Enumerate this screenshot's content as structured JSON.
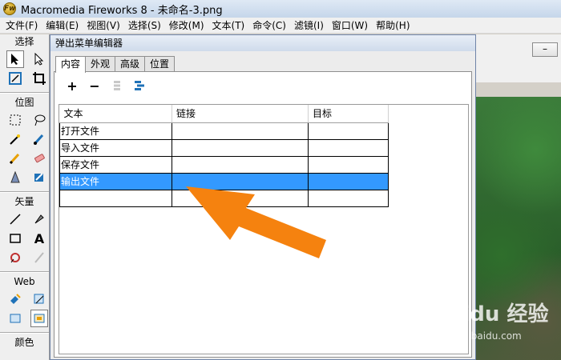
{
  "window": {
    "title": "Macromedia Fireworks 8 - 未命名-3.png",
    "logo": "Fw"
  },
  "menubar": {
    "items": [
      "文件(F)",
      "编辑(E)",
      "视图(V)",
      "选择(S)",
      "修改(M)",
      "文本(T)",
      "命令(C)",
      "滤镜(I)",
      "窗口(W)",
      "帮助(H)"
    ]
  },
  "toolbox": {
    "sections": {
      "select": "选择",
      "bitmap": "位图",
      "vector": "矢量",
      "web": "Web",
      "colors": "颜色"
    },
    "vector_text_tool": "A"
  },
  "dialog": {
    "title": "弹出菜单编辑器",
    "tabs": [
      "内容",
      "外观",
      "高级",
      "位置"
    ],
    "toolbar": {
      "add": "+",
      "remove": "−"
    },
    "table": {
      "headers": [
        "文本",
        "链接",
        "目标"
      ],
      "rows": [
        [
          "打开文件",
          "",
          ""
        ],
        [
          "导入文件",
          "",
          ""
        ],
        [
          "保存文件",
          "",
          ""
        ],
        [
          "输出文件",
          "",
          ""
        ],
        [
          "",
          "",
          ""
        ]
      ],
      "selected_row": 3
    }
  },
  "document": {
    "minimize": "–"
  },
  "watermark": {
    "main": "Baidu 经验",
    "sub": "jingyan.baidu.com"
  },
  "annotation": {
    "arrow_color": "#f5820f"
  },
  "colors": {
    "selection": "#3399ff"
  }
}
